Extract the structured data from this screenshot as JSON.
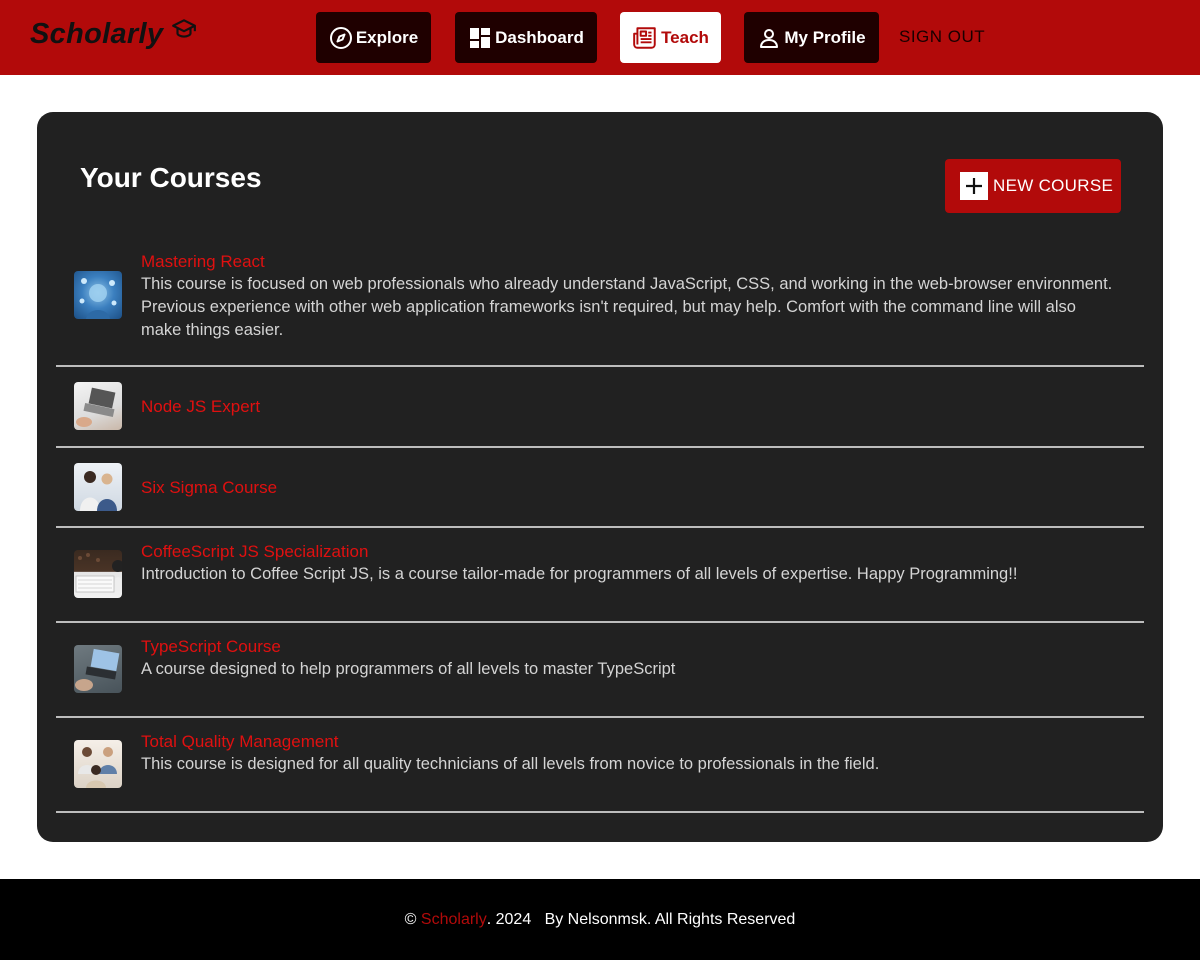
{
  "header": {
    "brand": "Scholarly",
    "brand_icon": "graduation-cap-icon",
    "nav": [
      {
        "label": "Explore",
        "icon": "compass-icon",
        "active": false
      },
      {
        "label": "Dashboard",
        "icon": "dashboard-icon",
        "active": false
      },
      {
        "label": "Teach",
        "icon": "newspaper-icon",
        "active": true
      },
      {
        "label": "My Profile",
        "icon": "person-icon",
        "active": false
      }
    ],
    "signout": "SIGN OUT"
  },
  "main": {
    "title": "Your Courses",
    "new_course_label": "NEW COURSE",
    "courses": [
      {
        "title": "Mastering React",
        "description": "This course is focused on web professionals who already understand JavaScript, CSS, and working in the web-browser environment. Previous experience with other web application frameworks isn't required, but may help. Comfort with the command line will also make things easier."
      },
      {
        "title": "Node JS Expert",
        "description": ""
      },
      {
        "title": "Six Sigma Course",
        "description": ""
      },
      {
        "title": "CoffeeScript JS Specialization",
        "description": "Introduction to Coffee Script JS, is a course tailor-made for programmers of all levels of expertise. Happy Programming!!"
      },
      {
        "title": "TypeScript Course",
        "description": "A course designed to help programmers of all levels to master TypeScript"
      },
      {
        "title": "Total Quality Management",
        "description": "This course is designed for all quality technicians of all levels from novice to professionals in the field."
      }
    ]
  },
  "footer": {
    "copyright": "©",
    "brand": "Scholarly",
    "year_text": ". 2024",
    "byline": "By Nelsonmsk. All Rights Reserved"
  },
  "colors": {
    "brand_red": "#b20a0a",
    "card_bg": "#212121",
    "footer_bg": "#000000",
    "link_red": "#e01010"
  }
}
